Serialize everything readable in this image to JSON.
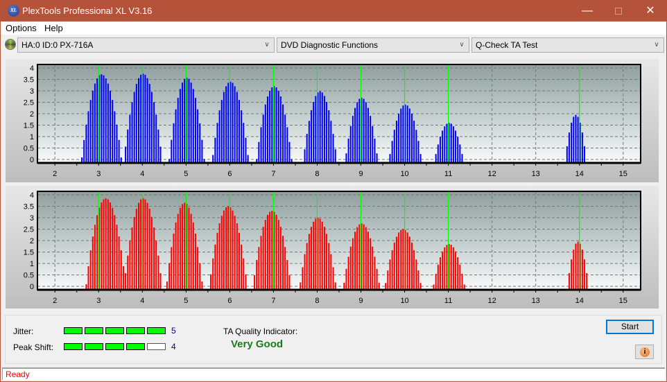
{
  "window": {
    "title": "PlexTools Professional XL V3.16",
    "icon": "xl-logo-icon",
    "min": "minimize-icon",
    "max": "maximize-icon",
    "close": "close-icon"
  },
  "menu": {
    "items": [
      "Options",
      "Help"
    ]
  },
  "toolbar": {
    "drive": "HA:0 ID:0  PX-716A",
    "function": "DVD Diagnostic Functions",
    "test": "Q-Check TA Test"
  },
  "chart_data": [
    {
      "type": "bar",
      "name": "TA histogram (lands/upper)",
      "color": "#0000ff",
      "xlim": [
        1.6,
        15.4
      ],
      "ylim": [
        -0.15,
        4.15
      ],
      "xticks": [
        2,
        3,
        4,
        5,
        6,
        7,
        8,
        9,
        10,
        11,
        12,
        13,
        14,
        15
      ],
      "yticks": [
        "0",
        "0.5",
        "1",
        "1.5",
        "2",
        "2.5",
        "3",
        "3.5",
        "4"
      ],
      "reference_lines_x": [
        3,
        4,
        5,
        6,
        7,
        8,
        9,
        10,
        11,
        14
      ],
      "peaks": [
        {
          "center": 3.05,
          "height": 3.72,
          "halfwidth": 0.42
        },
        {
          "center": 4.0,
          "height": 3.75,
          "halfwidth": 0.4
        },
        {
          "center": 5.0,
          "height": 3.58,
          "halfwidth": 0.37
        },
        {
          "center": 6.0,
          "height": 3.4,
          "halfwidth": 0.38
        },
        {
          "center": 7.0,
          "height": 3.2,
          "halfwidth": 0.37
        },
        {
          "center": 8.05,
          "height": 2.98,
          "halfwidth": 0.35
        },
        {
          "center": 9.0,
          "height": 2.7,
          "halfwidth": 0.34
        },
        {
          "center": 10.0,
          "height": 2.4,
          "halfwidth": 0.34
        },
        {
          "center": 11.0,
          "height": 1.6,
          "halfwidth": 0.3
        },
        {
          "center": 13.9,
          "height": 1.95,
          "halfwidth": 0.22
        }
      ]
    },
    {
      "type": "bar",
      "name": "TA histogram (pits/lower)",
      "color": "#ff0000",
      "xlim": [
        1.6,
        15.4
      ],
      "ylim": [
        -0.15,
        4.15
      ],
      "xticks": [
        2,
        3,
        4,
        5,
        6,
        7,
        8,
        9,
        10,
        11,
        12,
        13,
        14,
        15
      ],
      "yticks": [
        "0",
        "0.5",
        "1",
        "1.5",
        "2",
        "2.5",
        "3",
        "3.5",
        "4"
      ],
      "reference_lines_x": [
        3,
        4,
        5,
        6,
        7,
        8,
        9,
        10,
        11,
        14
      ],
      "peaks": [
        {
          "center": 3.15,
          "height": 3.85,
          "halfwidth": 0.42
        },
        {
          "center": 4.0,
          "height": 3.85,
          "halfwidth": 0.4
        },
        {
          "center": 4.95,
          "height": 3.65,
          "halfwidth": 0.38
        },
        {
          "center": 5.95,
          "height": 3.5,
          "halfwidth": 0.4
        },
        {
          "center": 6.95,
          "height": 3.3,
          "halfwidth": 0.4
        },
        {
          "center": 8.0,
          "height": 3.0,
          "halfwidth": 0.38
        },
        {
          "center": 9.0,
          "height": 2.75,
          "halfwidth": 0.38
        },
        {
          "center": 9.95,
          "height": 2.5,
          "halfwidth": 0.38
        },
        {
          "center": 11.0,
          "height": 1.85,
          "halfwidth": 0.33
        },
        {
          "center": 13.95,
          "height": 1.95,
          "halfwidth": 0.22
        }
      ]
    }
  ],
  "results": {
    "jitter_label": "Jitter:",
    "jitter_value": "5",
    "jitter_level": 5,
    "peak_shift_label": "Peak Shift:",
    "peak_shift_value": "4",
    "peak_shift_level": 4,
    "meter_max": 5,
    "ta_label": "TA Quality Indicator:",
    "ta_value": "Very Good"
  },
  "buttons": {
    "start": "Start",
    "info": "i"
  },
  "status": {
    "text": "Ready"
  }
}
